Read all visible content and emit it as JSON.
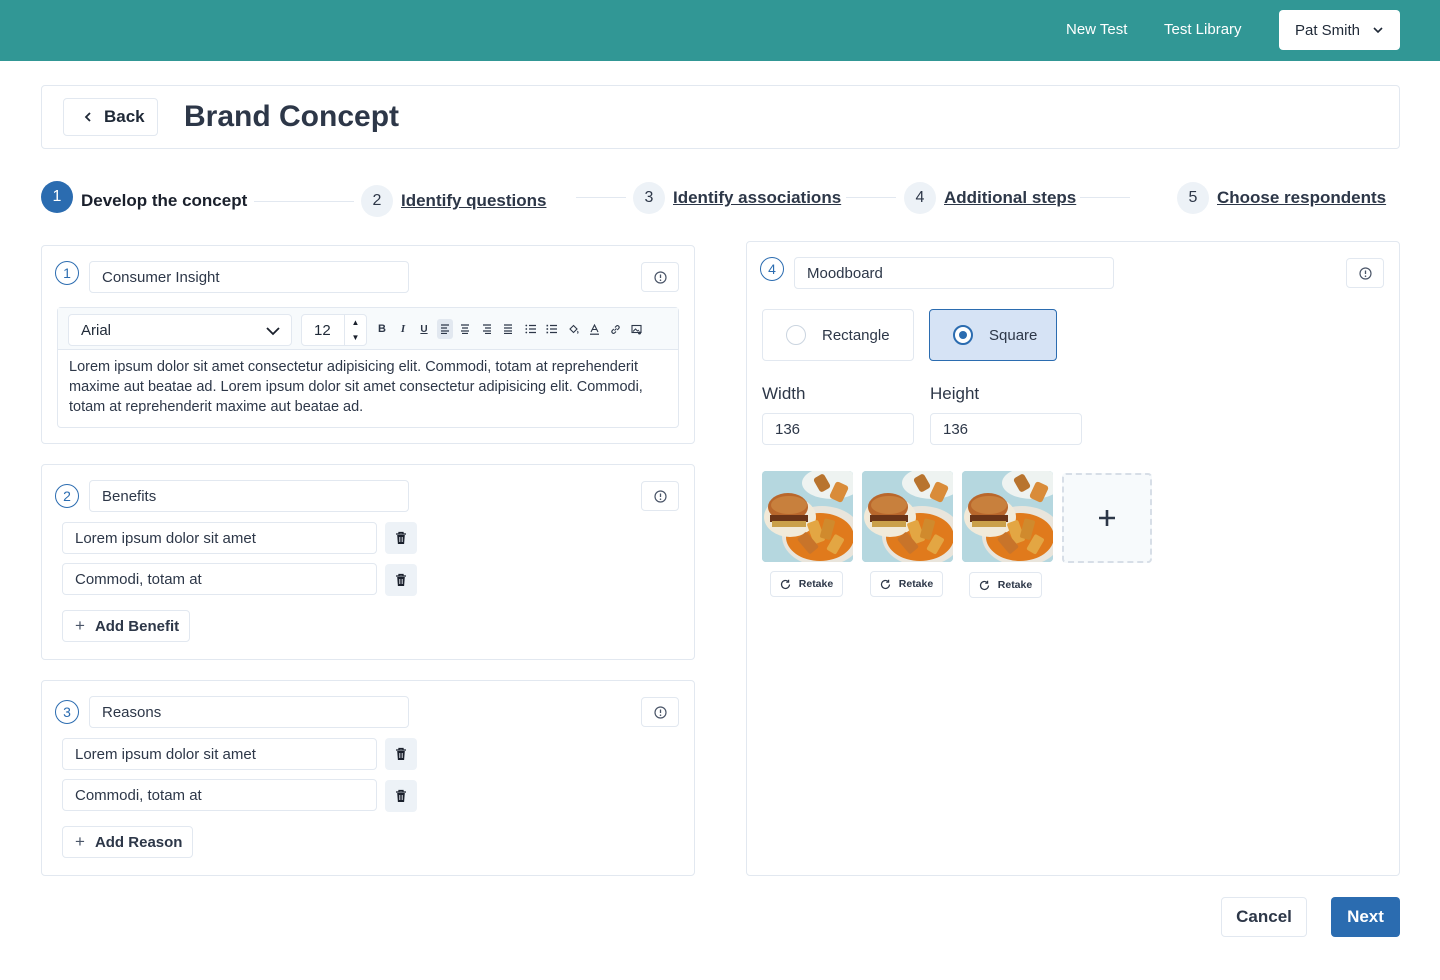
{
  "nav": {
    "new_test": "New Test",
    "test_library": "Test Library",
    "user": "Pat Smith"
  },
  "header": {
    "back_label": "Back",
    "title": "Brand Concept"
  },
  "steps": [
    {
      "num": "1",
      "label": "Develop the concept"
    },
    {
      "num": "2",
      "label": "Identify questions"
    },
    {
      "num": "3",
      "label": "Identify associations"
    },
    {
      "num": "4",
      "label": "Additional steps"
    },
    {
      "num": "5",
      "label": "Choose respondents"
    }
  ],
  "sections": {
    "insight": {
      "num": "1",
      "title": "Consumer Insight",
      "font": "Arial",
      "font_size": "12",
      "body": "Lorem ipsum dolor sit amet consectetur adipisicing elit. Commodi, totam at reprehenderit maxime aut beatae ad. Lorem ipsum dolor sit amet consectetur adipisicing elit.  Commodi, totam at reprehenderit maxime aut beatae ad."
    },
    "benefits": {
      "num": "2",
      "title": "Benefits",
      "items": [
        "Lorem ipsum dolor sit amet",
        "Commodi, totam at"
      ],
      "add_label": "Add Benefit"
    },
    "reasons": {
      "num": "3",
      "title": "Reasons",
      "items": [
        "Lorem ipsum dolor sit amet",
        "Commodi, totam at"
      ],
      "add_label": "Add Reason"
    },
    "moodboard": {
      "num": "4",
      "title": "Moodboard",
      "shape_options": [
        "Rectangle",
        "Square"
      ],
      "selected_shape": "Square",
      "width_label": "Width",
      "width_value": "136",
      "height_label": "Height",
      "height_value": "136",
      "retake_label": "Retake"
    }
  },
  "footer": {
    "cancel_label": "Cancel",
    "next_label": "Next"
  },
  "colors": {
    "topbar": "#319795",
    "primary": "#2b6cb0"
  }
}
